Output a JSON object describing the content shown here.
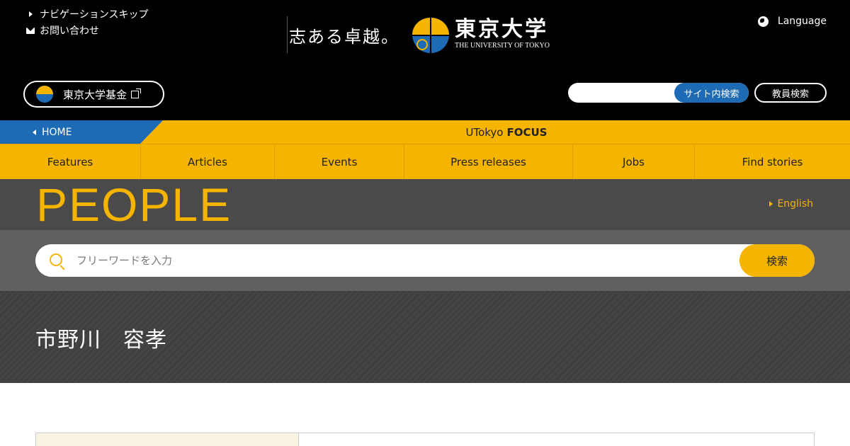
{
  "header": {
    "skip_nav": "ナビゲーションスキップ",
    "contact": "お問い合わせ",
    "motto": "志ある卓越。",
    "university_jp": "東京大学",
    "university_en": "THE UNIVERSITY OF TOKYO",
    "language": "Language",
    "fund": "東京大学基金",
    "site_search_placeholder": "",
    "site_search_button": "サイト内検索",
    "faculty_search": "教員検索"
  },
  "focus_bar": {
    "home": "HOME",
    "title_prefix": "UTokyo",
    "title_bold": "FOCUS"
  },
  "nav": {
    "items": [
      "Features",
      "Articles",
      "Events",
      "Press releases",
      "Jobs",
      "Find stories"
    ]
  },
  "people": {
    "title": "PEOPLE",
    "english": "English",
    "search_placeholder": "フリーワードを入力",
    "search_button": "検索"
  },
  "profile": {
    "name": "市野川　容孝"
  },
  "colors": {
    "gold": "#f5b400",
    "blue": "#1d6bb5",
    "black": "#000000",
    "band_gray": "#4a4a4a"
  }
}
